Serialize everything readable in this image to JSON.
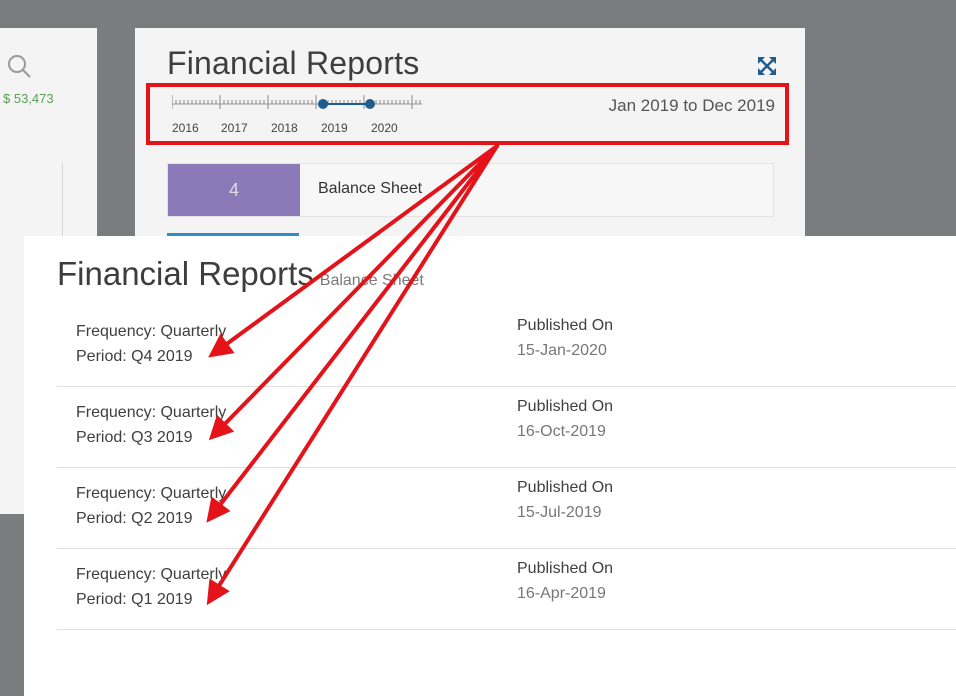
{
  "left_card": {
    "amount": "$ 53,473"
  },
  "card": {
    "title": "Financial Reports",
    "timeline_years": [
      "2016",
      "2017",
      "2018",
      "2019",
      "2020"
    ],
    "range_text": "Jan 2019 to Dec 2019",
    "balance_sheet_count": "4",
    "balance_sheet_label": "Balance Sheet"
  },
  "modal": {
    "title": "Financial Reports",
    "subtitle": "Balance Sheet",
    "reports": [
      {
        "frequency": "Frequency: Quarterly",
        "period": "Period: Q4 2019",
        "published_label": "Published On",
        "published_date": "15-Jan-2020"
      },
      {
        "frequency": "Frequency: Quarterly",
        "period": "Period: Q3 2019",
        "published_label": "Published On",
        "published_date": "16-Oct-2019"
      },
      {
        "frequency": "Frequency: Quarterly",
        "period": "Period: Q2 2019",
        "published_label": "Published On",
        "published_date": "15-Jul-2019"
      },
      {
        "frequency": "Frequency: Quarterly",
        "period": "Period: Q1 2019",
        "published_label": "Published On",
        "published_date": "16-Apr-2019"
      }
    ]
  },
  "colors": {
    "annotation": "#e4131a",
    "accent_purple": "#8c7ab8",
    "timeline_blue": "#1f5d8e",
    "amount_green": "#5aa055"
  },
  "icons": [
    "search-icon",
    "expand-icon"
  ]
}
